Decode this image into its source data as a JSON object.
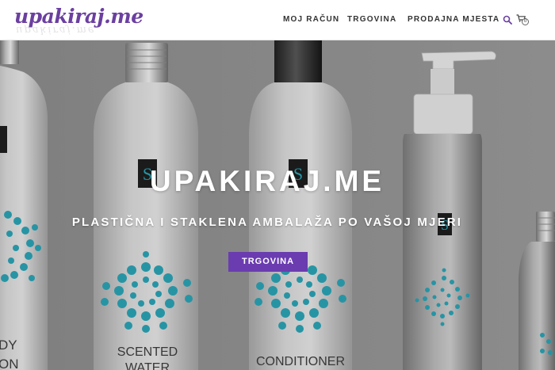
{
  "header": {
    "logo_text": "upakiraj.me",
    "nav": [
      {
        "label": "MOJ RAČUN"
      },
      {
        "label": "TRGOVINA"
      },
      {
        "label": "PRODAJNA MJESTA"
      }
    ],
    "cart_count": "0",
    "icons": {
      "search": "search-icon",
      "cart": "cart-icon"
    }
  },
  "hero": {
    "title": "UPAKIRAJ.ME",
    "subtitle": "PLASTIČNA I STAKLENA AMBALAŽA PO VAŠOJ MJERI",
    "button_label": "TRGOVINA",
    "bottle_labels": {
      "b1_line1": "DY",
      "b1_line2": "ON",
      "b2_line1": "SCENTED",
      "b2_line2": "WATER",
      "b3_line1": "CONDITIONER",
      "badge": "S"
    }
  },
  "colors": {
    "brand": "#6b3fa0",
    "button": "#6a3cb0",
    "accent_dots": "#27a3b5"
  }
}
